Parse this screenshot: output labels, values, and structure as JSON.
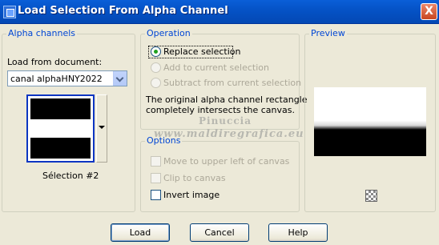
{
  "window": {
    "title": "Load Selection From Alpha Channel",
    "close_glyph": "X"
  },
  "alpha_channels": {
    "group_label": "Alpha channels",
    "load_from_label": "Load from document:",
    "document_value": "canal alphaHNY2022",
    "selection_name": "Sélection #2"
  },
  "operation": {
    "group_label": "Operation",
    "options": [
      {
        "label": "Replace selection",
        "selected": true,
        "enabled": true
      },
      {
        "label": "Add to current selection",
        "selected": false,
        "enabled": false
      },
      {
        "label": "Subtract from current selection",
        "selected": false,
        "enabled": false
      }
    ],
    "info_line1": "The original alpha channel rectangle",
    "info_line2": "completely intersects the canvas."
  },
  "options": {
    "group_label": "Options",
    "items": [
      {
        "label": "Move to upper left of canvas",
        "checked": false,
        "enabled": false
      },
      {
        "label": "Clip to canvas",
        "checked": false,
        "enabled": false
      },
      {
        "label": "Invert image",
        "checked": false,
        "enabled": true
      }
    ]
  },
  "preview": {
    "group_label": "Preview",
    "toggle_icon": "checkerboard-icon"
  },
  "watermark": {
    "line1": "Pinuccia",
    "line2": "www.maldiregrafica.eu"
  },
  "buttons": {
    "load": "Load",
    "cancel": "Cancel",
    "help": "Help"
  },
  "colors": {
    "titlebar": "#0553c7",
    "group_label": "#0046d5",
    "dialog_bg": "#ece9d8"
  }
}
